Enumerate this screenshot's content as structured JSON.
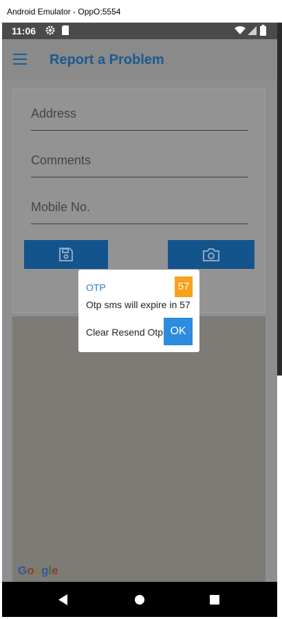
{
  "window": {
    "title": "Android Emulator - OppO:5554"
  },
  "status_bar": {
    "time": "11:06",
    "icons": [
      "gear-icon",
      "sd-card-icon",
      "wifi-icon",
      "signal-icon",
      "battery-icon"
    ]
  },
  "app_bar": {
    "title": "Report a Problem",
    "menu_icon": "hamburger-menu-icon"
  },
  "form": {
    "address_placeholder": "Address",
    "comments_placeholder": "Comments",
    "mobile_placeholder": "Mobile No.",
    "save_icon": "save-icon",
    "camera_icon": "camera-icon"
  },
  "map": {
    "attribution": "Google"
  },
  "dialog": {
    "title": "OTP",
    "countdown": "57",
    "message": "Otp sms will expire in 57",
    "resend_label": "Clear Resend Otp",
    "ok_label": "OK"
  },
  "nav_bar": {
    "buttons": [
      "back-icon",
      "home-icon",
      "recents-icon"
    ]
  },
  "colors": {
    "primary": "#14548d",
    "title_text": "#1a5a90",
    "countdown_bg": "#f7a21c",
    "ok_button": "#2d8be0",
    "dialog_title": "#2a7fc8"
  }
}
